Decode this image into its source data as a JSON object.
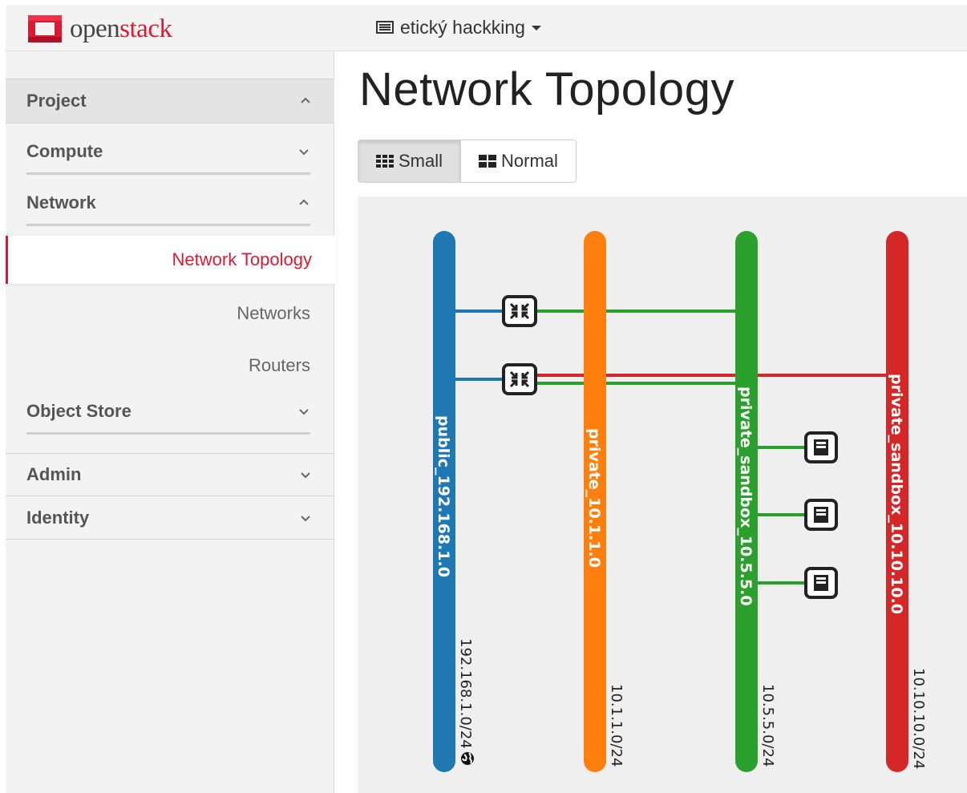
{
  "header": {
    "brand": {
      "prefix": "open",
      "suffix": "stack",
      "accent_color": "#da1a32"
    },
    "project": {
      "name": "etický hackking",
      "icon": "server-list-icon"
    }
  },
  "sidebar": {
    "project_label": "Project",
    "compute_label": "Compute",
    "network_label": "Network",
    "network_items": [
      {
        "label": "Network Topology",
        "active": true
      },
      {
        "label": "Networks",
        "active": false
      },
      {
        "label": "Routers",
        "active": false
      }
    ],
    "object_store_label": "Object Store",
    "admin_label": "Admin",
    "identity_label": "Identity"
  },
  "main": {
    "title": "Network Topology",
    "view_toggle": {
      "small_label": "Small",
      "normal_label": "Normal",
      "selected": "Small"
    }
  },
  "topology": {
    "networks": [
      {
        "id": "public",
        "label": "public_192.168.1.0",
        "cidr": "192.168.1.0/24",
        "color": "#1f77b4",
        "external": true
      },
      {
        "id": "private",
        "label": "private_10.1.1.0",
        "cidr": "10.1.1.0/24",
        "color": "#ff7f0e",
        "external": false
      },
      {
        "id": "sandbox",
        "label": "private_sandbox_10.5.5.0",
        "cidr": "10.5.5.0/24",
        "color": "#2ca02c",
        "external": false
      },
      {
        "id": "sandbox2",
        "label": "private_sandbox_10.10.10.0",
        "cidr": "10.10.10.0/24",
        "color": "#d62728",
        "external": false
      }
    ],
    "routers": [
      {
        "id": "router-1",
        "links": [
          "public",
          "sandbox"
        ]
      },
      {
        "id": "router-2",
        "links": [
          "public",
          "sandbox2",
          "sandbox"
        ]
      }
    ],
    "instances": [
      {
        "id": "instance-1",
        "network": "sandbox"
      },
      {
        "id": "instance-2",
        "network": "sandbox"
      },
      {
        "id": "instance-3",
        "network": "sandbox"
      }
    ]
  }
}
